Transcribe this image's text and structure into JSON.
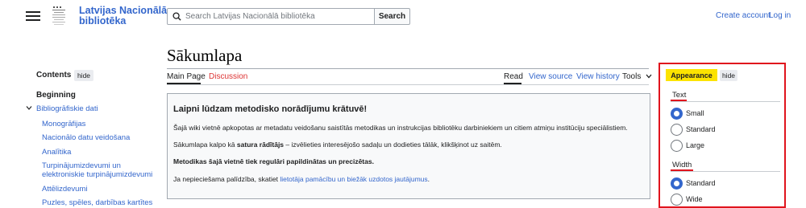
{
  "header": {
    "site_name_line1": "Latvijas Nacionālā",
    "site_name_line2": "bibliotēka",
    "search_placeholder": "Search Latvijas Nacionālā bibliotēka",
    "search_button": "Search",
    "create_account": "Create account",
    "log_in": "Log in"
  },
  "page": {
    "title": "Sākumlapa",
    "tabs_left": [
      "Main Page",
      "Discussion"
    ],
    "tabs_right": [
      "Read",
      "View source",
      "View history",
      "Tools"
    ]
  },
  "sidebar": {
    "contents_label": "Contents",
    "hide_label": "hide",
    "beginning": "Beginning",
    "section": "Bibliogrāfiskie dati",
    "items": [
      "Monogrāfijas",
      "Nacionālo datu veidošana",
      "Analītika",
      "Turpinājumizdevumi un",
      "elektroniskie turpinājumizdevumi",
      "Attēlizdevumi",
      "Puzles, spēles, darbības kartītes"
    ]
  },
  "notice": {
    "title": "Laipni lūdzam metodisko norādījumu krātuvē!",
    "p1": "Šajā wiki vietnē apkopotas ar metadatu veidošanu saistītās metodikas un instrukcijas bibliotēku darbiniekiem un citiem atmiņu institūciju speciālistiem.",
    "p2_pre": "Sākumlapa kalpo kā ",
    "p2_bold": "satura rādītājs",
    "p2_post": " – izvēlieties interesējošo sadaļu un dodieties tālāk, klikšķinot uz saitēm.",
    "p3": "Metodikas šajā vietnē tiek regulāri papildinātas un precizētas.",
    "p4_pre": "Ja nepieciešama palīdzība, skatiet ",
    "p4_link": "lietotāja pamācību un biežāk uzdotos jautājumus",
    "p4_post": "."
  },
  "appearance": {
    "title": "Appearance",
    "hide_label": "hide",
    "text_label": "Text",
    "text_options": [
      "Small",
      "Standard",
      "Large"
    ],
    "text_selected": "Small",
    "width_label": "Width",
    "width_options": [
      "Standard",
      "Wide"
    ],
    "width_selected": "Standard"
  },
  "colors": {
    "link": "#3366cc",
    "red_link": "#dd3333",
    "highlight": "#fce300",
    "annotation_red": "#e0141d"
  }
}
